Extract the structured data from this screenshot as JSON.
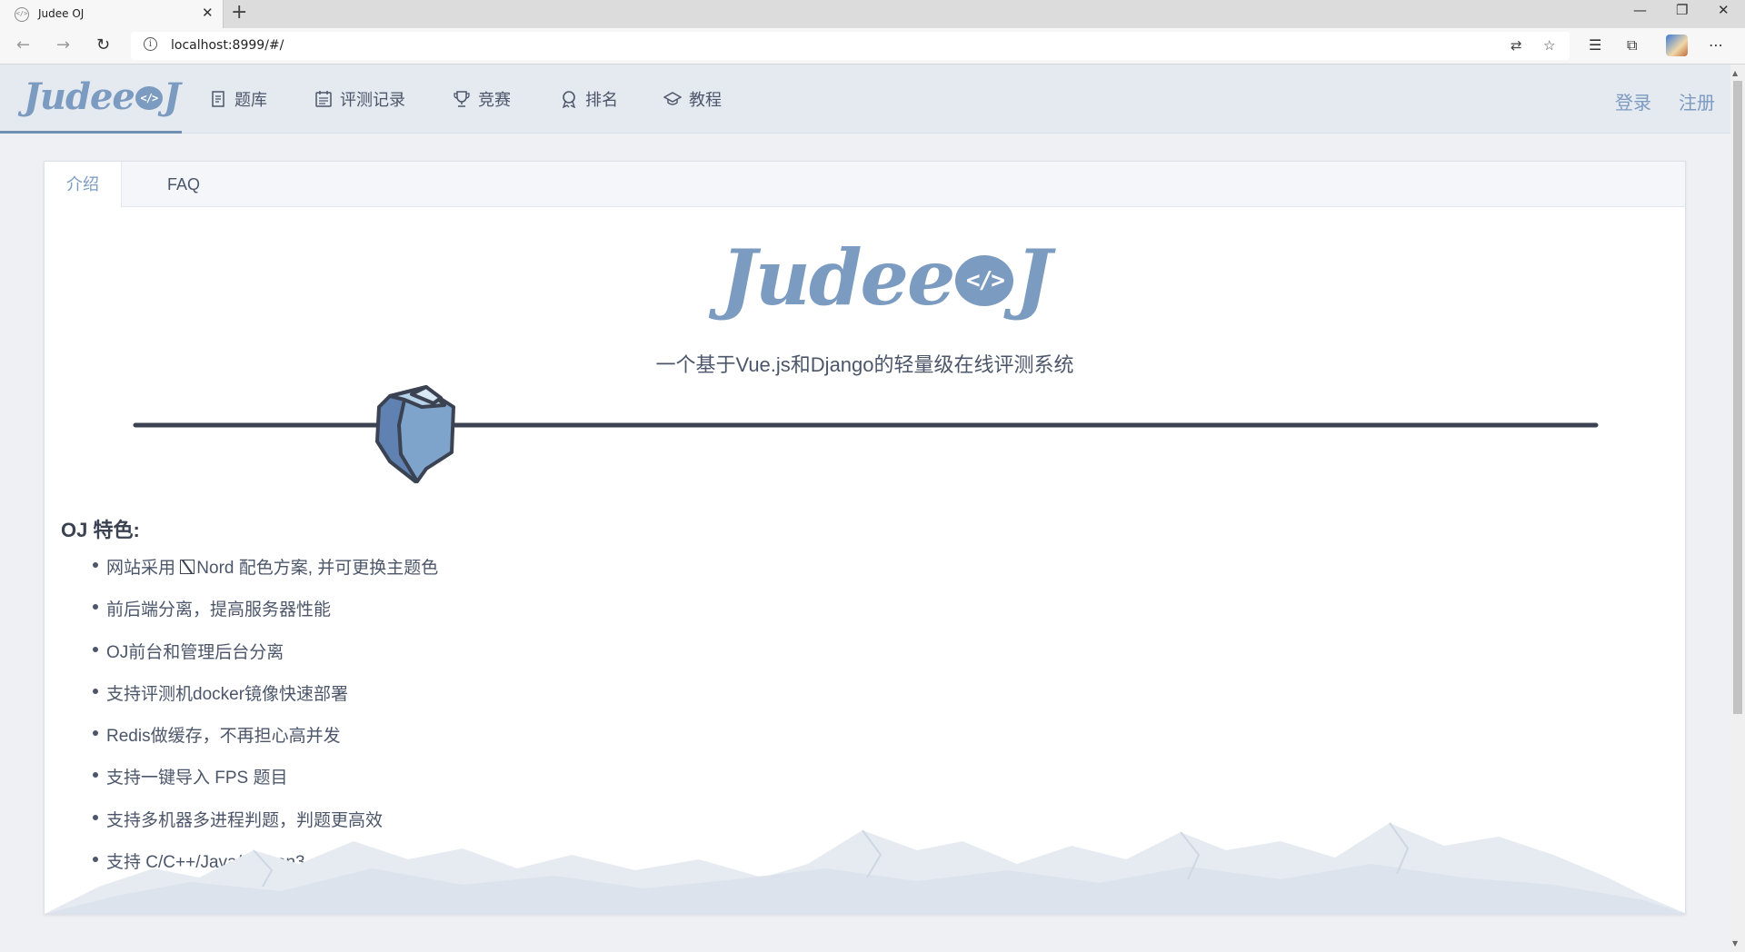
{
  "browser": {
    "tab_title": "Judee OJ",
    "tab_close": "✕",
    "new_tab": "+",
    "url": "localhost:8999/#/",
    "window_controls": [
      "—",
      "❐",
      "✕"
    ]
  },
  "navbar": {
    "logo_text": "Judee",
    "logo_bubble": "</>",
    "logo_tail": "J",
    "items": [
      {
        "label": "题库",
        "icon": "document-icon"
      },
      {
        "label": "评测记录",
        "icon": "list-icon"
      },
      {
        "label": "竞赛",
        "icon": "trophy-icon"
      },
      {
        "label": "排名",
        "icon": "medal-icon"
      },
      {
        "label": "教程",
        "icon": "graduation-cap-icon"
      }
    ],
    "login": "登录",
    "register": "注册"
  },
  "tabs": [
    {
      "label": "介绍",
      "active": true
    },
    {
      "label": "FAQ",
      "active": false
    }
  ],
  "hero": {
    "logo_text": "Judee",
    "logo_bubble": "</>",
    "logo_tail": "J",
    "subtitle": "一个基于Vue.js和Django的轻量级在线评测系统"
  },
  "features": {
    "title": "OJ 特色:",
    "items": [
      {
        "prefix": "网站采用 ",
        "suffix": "Nord 配色方案, 并可更换主题色",
        "has_icon": true
      },
      {
        "text": "前后端分离，提高服务器性能"
      },
      {
        "text": "OJ前台和管理后台分离"
      },
      {
        "text": "支持评测机docker镜像快速部署"
      },
      {
        "text": "Redis做缓存，不再担心高并发"
      },
      {
        "text": "支持一键导入 FPS 题目"
      },
      {
        "text": "支持多机器多进程判题，判题更高效"
      },
      {
        "text": "支持 C/C++/Java/Python3"
      }
    ]
  },
  "colors": {
    "accent": "#7b9bc0",
    "text": "#4c566a",
    "nav_bg": "#e5e9f0",
    "page_bg": "#eef0f4"
  }
}
